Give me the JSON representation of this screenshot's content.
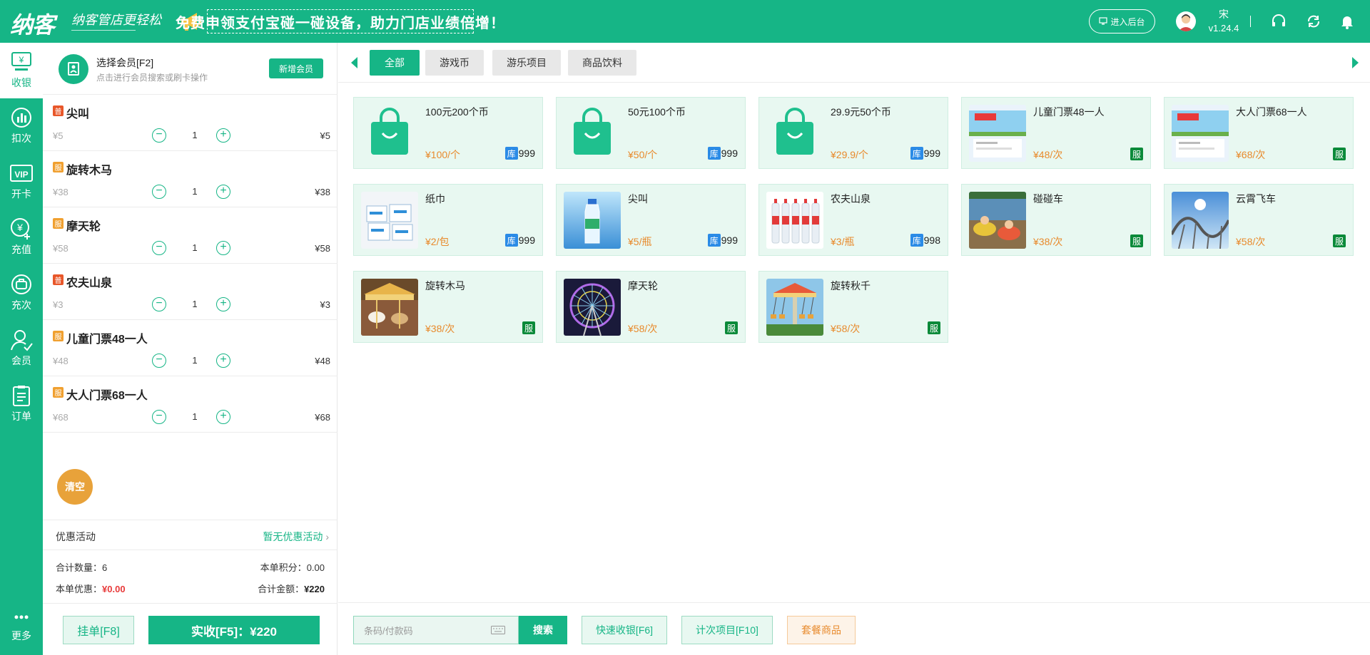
{
  "brand": {
    "logo": "纳客",
    "slogan": "纳客管店更轻松",
    "banner": "免费申领支付宝碰一碰设备，助力门店业绩倍增！"
  },
  "topbar": {
    "backend_label": "进入后台",
    "user_name": "宋",
    "version": "v1.24.4"
  },
  "nav": [
    {
      "label": "收银",
      "icon": "cashier-icon",
      "active": true
    },
    {
      "label": "扣次",
      "icon": "deduct-chart-icon"
    },
    {
      "label": "开卡",
      "icon": "vip-card-icon"
    },
    {
      "label": "充值",
      "icon": "recharge-yen-icon"
    },
    {
      "label": "充次",
      "icon": "recharge-count-icon"
    },
    {
      "label": "会员",
      "icon": "member-icon"
    },
    {
      "label": "订单",
      "icon": "order-clipboard-icon"
    },
    {
      "label": "更多",
      "icon": "more-dots-icon"
    }
  ],
  "member": {
    "title": "选择会员[F2]",
    "subtitle": "点击进行会员搜索或刷卡操作",
    "add_label": "新增会员"
  },
  "cart": {
    "items": [
      {
        "badge": "普",
        "badge_color": "#e8572a",
        "name": "尖叫",
        "unit": "¥5",
        "qty": "1",
        "total": "¥5"
      },
      {
        "badge": "服",
        "badge_color": "#f0a030",
        "name": "旋转木马",
        "unit": "¥38",
        "qty": "1",
        "total": "¥38"
      },
      {
        "badge": "服",
        "badge_color": "#f0a030",
        "name": "摩天轮",
        "unit": "¥58",
        "qty": "1",
        "total": "¥58"
      },
      {
        "badge": "普",
        "badge_color": "#e8572a",
        "name": "农夫山泉",
        "unit": "¥3",
        "qty": "1",
        "total": "¥3"
      },
      {
        "badge": "服",
        "badge_color": "#f0a030",
        "name": "儿童门票48一人",
        "unit": "¥48",
        "qty": "1",
        "total": "¥48"
      },
      {
        "badge": "服",
        "badge_color": "#f0a030",
        "name": "大人门票68一人",
        "unit": "¥68",
        "qty": "1",
        "total": "¥68"
      }
    ],
    "clear_label": "清空",
    "promo_label": "优惠活动",
    "promo_value": "暂无优惠活动",
    "total_qty_label": "合计数量：",
    "total_qty": "6",
    "points_label": "本单积分：",
    "points": "0.00",
    "discount_label": "本单优惠：",
    "discount": "¥0.00",
    "amount_label": "合计金额：",
    "amount": "¥220",
    "hold_label": "挂单[F8]",
    "pay_label": "实收[F5]：¥220"
  },
  "tabs": [
    "全部",
    "游戏币",
    "游乐项目",
    "商品饮料"
  ],
  "products": [
    {
      "name": "100元200个币",
      "price": "¥100/个",
      "stock_label": "库",
      "stock": "999",
      "image": "shopping-bag-icon"
    },
    {
      "name": "50元100个币",
      "price": "¥50/个",
      "stock_label": "库",
      "stock": "999",
      "image": "shopping-bag-icon"
    },
    {
      "name": "29.9元50个币",
      "price": "¥29.9/个",
      "stock_label": "库",
      "stock": "999",
      "image": "shopping-bag-icon"
    },
    {
      "name": "儿童门票48一人",
      "price": "¥48/次",
      "service_label": "服",
      "image": "ticket-photo"
    },
    {
      "name": "大人门票68一人",
      "price": "¥68/次",
      "service_label": "服",
      "image": "ticket-photo"
    },
    {
      "name": "纸巾",
      "price": "¥2/包",
      "stock_label": "库",
      "stock": "999",
      "image": "tissue-photo"
    },
    {
      "name": "尖叫",
      "price": "¥5/瓶",
      "stock_label": "库",
      "stock": "999",
      "image": "drink-bottle-photo"
    },
    {
      "name": "农夫山泉",
      "price": "¥3/瓶",
      "stock_label": "库",
      "stock": "998",
      "image": "water-bottles-photo"
    },
    {
      "name": "碰碰车",
      "price": "¥38/次",
      "service_label": "服",
      "image": "bumper-car-photo"
    },
    {
      "name": "云霄飞车",
      "price": "¥58/次",
      "service_label": "服",
      "image": "roller-coaster-photo"
    },
    {
      "name": "旋转木马",
      "price": "¥38/次",
      "service_label": "服",
      "image": "carousel-photo"
    },
    {
      "name": "摩天轮",
      "price": "¥58/次",
      "service_label": "服",
      "image": "ferris-wheel-photo"
    },
    {
      "name": "旋转秋千",
      "price": "¥58/次",
      "service_label": "服",
      "image": "swing-ride-photo"
    }
  ],
  "bottom": {
    "search_placeholder": "条码/付款码",
    "search_label": "搜索",
    "quick_cash_label": "快速收银[F6]",
    "count_items_label": "计次项目[F10]",
    "package_label": "套餐商品"
  }
}
